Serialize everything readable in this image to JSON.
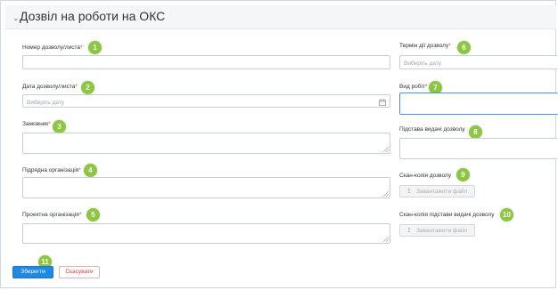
{
  "header": {
    "title": "Дозвіл на роботи на ОКС"
  },
  "fields": {
    "permit_number": {
      "label": "Номер дозволу/листа",
      "badge": "1"
    },
    "permit_date": {
      "label": "Дата дозволу/листа",
      "placeholder": "Виберіть дату",
      "badge": "2"
    },
    "customer": {
      "label": "Замовник",
      "badge": "3"
    },
    "contractor": {
      "label": "Підрядна організація",
      "badge": "4"
    },
    "design_org": {
      "label": "Проектна організація",
      "badge": "5"
    },
    "validity": {
      "label": "Термін дії дозволу",
      "placeholder": "Виберіть дату",
      "badge": "6"
    },
    "work_type": {
      "label": "Вид робіт",
      "badge": "7"
    },
    "basis": {
      "label": "Підстава видачі дозволу",
      "badge": "8"
    },
    "scan_permit": {
      "label": "Скан-копія дозволу",
      "button": "Завантажити файл",
      "badge": "9"
    },
    "scan_basis": {
      "label": "Скан-копія підстави видачі дозволу",
      "button": "Завантажити файл",
      "badge": "10"
    }
  },
  "required_mark": "*",
  "actions": {
    "save": "Зберегти",
    "cancel": "Скасувати",
    "badge": "11"
  },
  "colors": {
    "badge": "#8dc63f",
    "primary": "#1e88e5",
    "required": "#e53935",
    "focus": "#4a90e2"
  },
  "icons": {
    "collapse": "chevron-down-icon",
    "calendar": "calendar-icon",
    "upload": "upload-icon"
  }
}
